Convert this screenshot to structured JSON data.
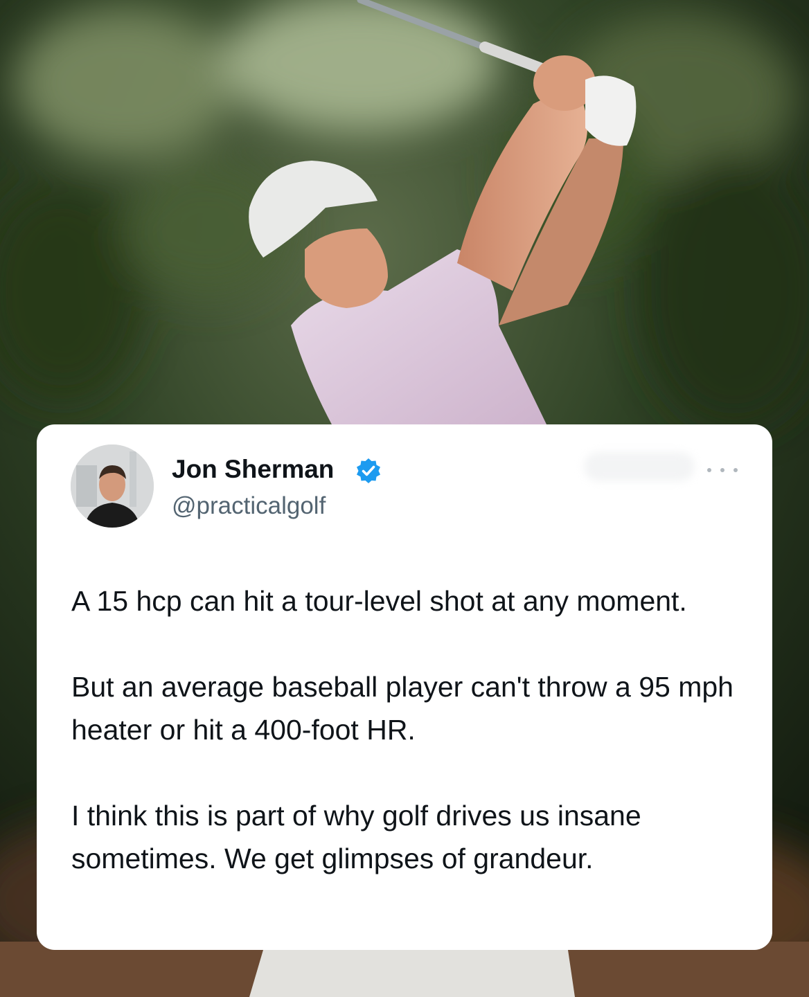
{
  "background": {
    "description_icon": "golfer-photo",
    "colors": {
      "foliage": "#2b3d1f",
      "shirt": "#dcc7d9",
      "cap": "#e6e7e6",
      "skin": "#d99c7c"
    }
  },
  "tweet": {
    "author": {
      "name": "Jon Sherman",
      "handle": "@practicalgolf",
      "verified_icon": "verified-badge-icon",
      "verified_color": "#1d9bf0"
    },
    "more_icon": "more-options-icon",
    "paragraphs": [
      "A 15 hcp can hit a tour-level shot at any moment.",
      "But an average baseball player can't throw a 95 mph heater or hit a 400-foot HR.",
      "I think this is part of why golf drives us insane sometimes. We get glimpses of grandeur."
    ]
  }
}
